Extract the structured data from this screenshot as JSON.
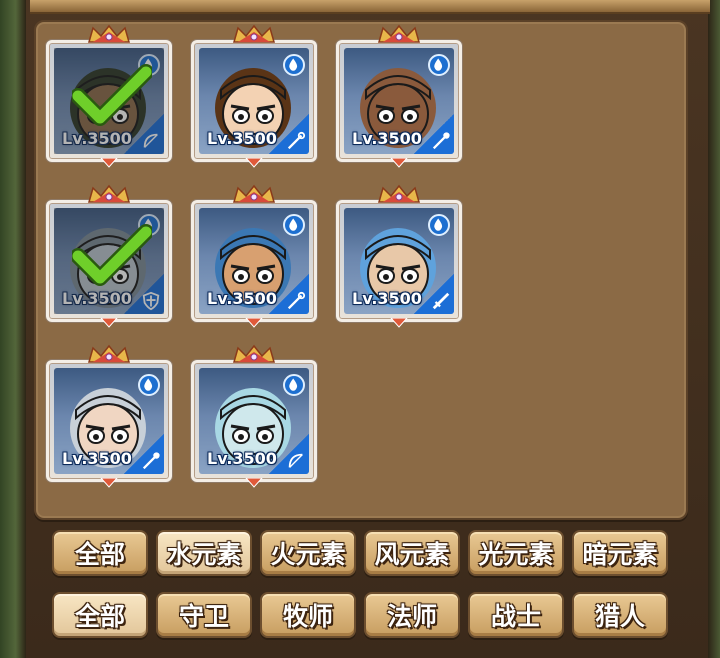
{
  "heroes": [
    {
      "level": "Lv.3500",
      "element": "water",
      "class_icon": "bow-icon",
      "selected": true,
      "skin": "#8a6a4a",
      "hair": "#2e3a28"
    },
    {
      "level": "Lv.3500",
      "element": "water",
      "class_icon": "staff-icon",
      "selected": false,
      "skin": "#f3d2b3",
      "hair": "#5a3416"
    },
    {
      "level": "Lv.3500",
      "element": "water",
      "class_icon": "wand-icon",
      "selected": false,
      "skin": "#8a5a3c",
      "hair": "#8a5a3c"
    },
    {
      "level": "Lv.3500",
      "element": "water",
      "class_icon": "shield-icon",
      "selected": true,
      "skin": "#b8c4cc",
      "hair": "#7c8a96"
    },
    {
      "level": "Lv.3500",
      "element": "water",
      "class_icon": "staff-icon",
      "selected": false,
      "skin": "#d8a070",
      "hair": "#3b78b4"
    },
    {
      "level": "Lv.3500",
      "element": "water",
      "class_icon": "sword-icon",
      "selected": false,
      "skin": "#e8c8a8",
      "hair": "#5fa2dc"
    },
    {
      "level": "Lv.3500",
      "element": "water",
      "class_icon": "wand-icon",
      "selected": false,
      "skin": "#f0d6c2",
      "hair": "#c8d0d8"
    },
    {
      "level": "Lv.3500",
      "element": "water",
      "class_icon": "bow-icon",
      "selected": false,
      "skin": "#cfe8ec",
      "hair": "#a8d8e4"
    }
  ],
  "element_tabs": [
    {
      "label": "全部",
      "active": false
    },
    {
      "label": "水元素",
      "active": true
    },
    {
      "label": "火元素",
      "active": false
    },
    {
      "label": "风元素",
      "active": false
    },
    {
      "label": "光元素",
      "active": false
    },
    {
      "label": "暗元素",
      "active": false
    }
  ],
  "class_tabs": [
    {
      "label": "全部",
      "active": true
    },
    {
      "label": "守卫",
      "active": false
    },
    {
      "label": "牧师",
      "active": false
    },
    {
      "label": "法师",
      "active": false
    },
    {
      "label": "战士",
      "active": false
    },
    {
      "label": "猎人",
      "active": false
    }
  ],
  "colors": {
    "panel": "#8b6a45",
    "water": "#1d6fd0",
    "check": "#6fcf2a"
  }
}
